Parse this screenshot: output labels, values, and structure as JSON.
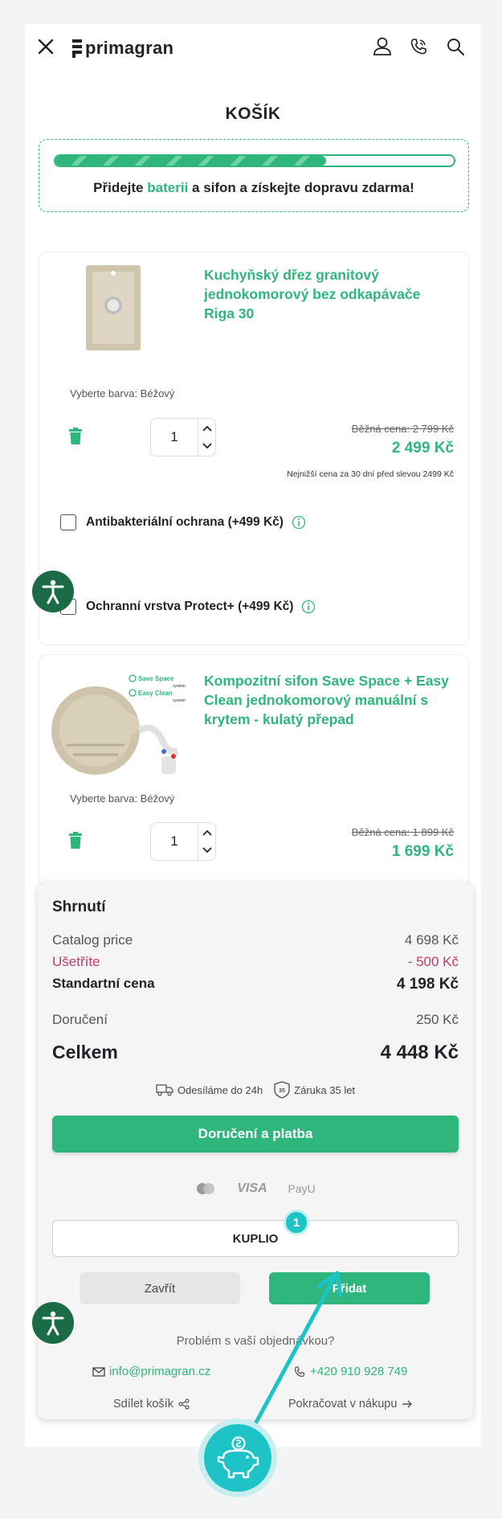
{
  "header": {
    "logo_text": "primagran",
    "icons": [
      "close-icon",
      "user-icon",
      "phone-icon",
      "search-icon"
    ]
  },
  "page_title": "KOŠÍK",
  "promo": {
    "progress_fraction": 0.68,
    "text_before": "Přidejte ",
    "highlight1": "baterii",
    "text_mid1": " a ",
    "highlight2": "sifon",
    "text_after": " a získejte dopravu zdarma!"
  },
  "items": [
    {
      "name": "Kuchyňský dřez granitový jednokomorový bez odkapávače Riga 30",
      "color_label": "Vyberte barva: Béžový",
      "quantity": "1",
      "old_price": "Běžná cena: 2 799 Kč",
      "price": "2 499 Kč",
      "lowest_note": "Nejnižší cena za 30 dní před slevou 2499 Kč",
      "options": [
        {
          "label": "Antibakteriální ochrana (+499 Kč)"
        },
        {
          "label": "Ochranní vrstva Protect+ (+499 Kč)"
        }
      ]
    },
    {
      "name": "Kompozitní sifon Save Space + Easy Clean jednokomorový manuální s krytem - kulatý přepad",
      "image_tags": [
        "Save Space",
        "system",
        "Easy Clean",
        "system"
      ],
      "color_label": "Vyberte barva: Béžový",
      "quantity": "1",
      "old_price": "Běžná cena: 1 899 Kč",
      "price": "1 699 Kč"
    }
  ],
  "summary": {
    "title": "Shrnutí",
    "catalog_label": "Catalog price",
    "catalog_value": "4 698 Kč",
    "save_label": "Ušetříte",
    "save_value": "- 500 Kč",
    "standard_label": "Standartní cena",
    "standard_value": "4 198 Kč",
    "delivery_label": "Doručení",
    "delivery_value": "250 Kč",
    "total_label": "Celkem",
    "total_value": "4 448 Kč",
    "badge_shipping": "Odesíláme do 24h",
    "badge_warranty": "Záruka 35 let",
    "badge_warranty_num": "35",
    "checkout_label": "Doručení a platba",
    "pay_visa": "VISA",
    "pay_payu": "PayU",
    "coupon_value": "KUPLIO",
    "step_number": "1",
    "close_label": "Zavřít",
    "add_label": "Přidat",
    "help_text": "Problém s vaší objednávkou?",
    "email": "info@primagran.cz",
    "phone": "+420 910 928 749",
    "share_label": "Sdílet košík",
    "continue_label": "Pokračovat v nákupu"
  },
  "colors": {
    "brand_green": "#2eb67d",
    "savings_red": "#c0396b",
    "accent_cyan": "#1ec3c8",
    "a11y_green": "#1b6b46"
  }
}
